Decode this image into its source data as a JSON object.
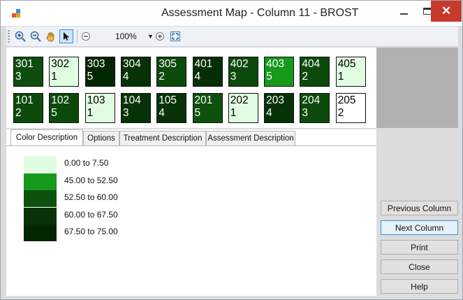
{
  "window": {
    "title": "Assessment Map - Column 11 - BROST",
    "close_glyph": "✕",
    "icons": {
      "app": "app-icon",
      "minimize": "minimize-icon",
      "maximize": "maximize-icon",
      "close": "close-icon"
    }
  },
  "toolbar": {
    "zoom_value": "100%",
    "icons": [
      "zoom-in-icon",
      "zoom-out-icon",
      "pan-hand-icon",
      "pointer-arrow-icon",
      "zoom-minus-icon",
      "zoom-dropdown-icon",
      "zoom-plus-icon",
      "fit-page-icon"
    ]
  },
  "plots": {
    "row1": [
      {
        "num": "301",
        "val": "3",
        "color": "#0d4d0d",
        "text_color": "#ffffff"
      },
      {
        "num": "302",
        "val": "1",
        "color": "#e1fde1",
        "text_color": "#000000"
      },
      {
        "num": "303",
        "val": "5",
        "color": "#022602",
        "text_color": "#ffffff"
      },
      {
        "num": "304",
        "val": "4",
        "color": "#073207",
        "text_color": "#ffffff"
      },
      {
        "num": "305",
        "val": "2",
        "color": "#0c4a0c",
        "text_color": "#ffffff"
      },
      {
        "num": "401",
        "val": "4",
        "color": "#062e06",
        "text_color": "#ffffff"
      },
      {
        "num": "402",
        "val": "3",
        "color": "#0c4a0c",
        "text_color": "#ffffff"
      },
      {
        "num": "403",
        "val": "5",
        "color": "#17991b",
        "text_color": "#ffffff"
      },
      {
        "num": "404",
        "val": "2",
        "color": "#0c4a0c",
        "text_color": "#ffffff"
      },
      {
        "num": "405",
        "val": "1",
        "color": "#e1fde1",
        "text_color": "#000000"
      }
    ],
    "row2": [
      {
        "num": "101",
        "val": "2",
        "color": "#0c4a0c",
        "text_color": "#ffffff"
      },
      {
        "num": "102",
        "val": "5",
        "color": "#0c4a0c",
        "text_color": "#ffffff"
      },
      {
        "num": "103",
        "val": "1",
        "color": "#e1fde1",
        "text_color": "#000000"
      },
      {
        "num": "104",
        "val": "3",
        "color": "#073207",
        "text_color": "#ffffff"
      },
      {
        "num": "105",
        "val": "4",
        "color": "#073207",
        "text_color": "#ffffff"
      },
      {
        "num": "201",
        "val": "5",
        "color": "#0d510d",
        "text_color": "#ffffff"
      },
      {
        "num": "202",
        "val": "1",
        "color": "#e1fde1",
        "text_color": "#000000"
      },
      {
        "num": "203",
        "val": "4",
        "color": "#073207",
        "text_color": "#ffffff"
      },
      {
        "num": "204",
        "val": "3",
        "color": "#0c4a0c",
        "text_color": "#ffffff"
      },
      {
        "num": "205",
        "val": "2",
        "color": "#ffffff",
        "text_color": "#000000"
      }
    ]
  },
  "tabs": [
    {
      "label": "Color Description",
      "active": true
    },
    {
      "label": "Options",
      "active": false
    },
    {
      "label": "Treatment Description",
      "active": false
    },
    {
      "label": "Assessment Description",
      "active": false
    }
  ],
  "legend": [
    {
      "label": "0.00 to 7.50",
      "color": "#e1fde1"
    },
    {
      "label": "45.00 to 52.50",
      "color": "#17991b"
    },
    {
      "label": "52.50 to 60.00",
      "color": "#0d510d"
    },
    {
      "label": "60.00 to 67.50",
      "color": "#073207"
    },
    {
      "label": "67.50 to 75.00",
      "color": "#022602"
    }
  ],
  "side_buttons": [
    {
      "label": "Previous Column",
      "focused": false
    },
    {
      "label": "Next Column",
      "focused": true
    },
    {
      "label": "Print",
      "focused": false
    },
    {
      "label": "Close",
      "focused": false
    },
    {
      "label": "Help",
      "focused": false
    }
  ]
}
